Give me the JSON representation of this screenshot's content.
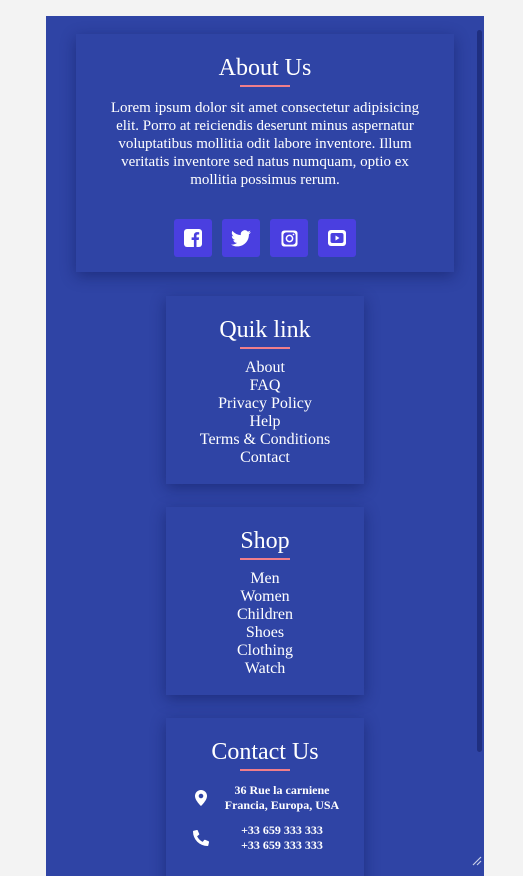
{
  "about": {
    "title": "About Us",
    "text": "Lorem ipsum dolor sit amet consectetur adipisicing elit. Porro at reiciendis deserunt minus aspernatur voluptatibus mollitia odit labore inventore. Illum veritatis inventore sed natus numquam, optio ex mollitia possimus rerum.",
    "socials": [
      "facebook-icon",
      "twitter-icon",
      "instagram-icon",
      "youtube-icon"
    ]
  },
  "quik": {
    "title": "Quik link",
    "links": [
      "About",
      "FAQ",
      "Privacy Policy",
      "Help",
      "Terms & Conditions",
      "Contact"
    ]
  },
  "shop": {
    "title": "Shop",
    "links": [
      "Men",
      "Women",
      "Children",
      "Shoes",
      "Clothing",
      "Watch"
    ]
  },
  "contact": {
    "title": "Contact Us",
    "address": "36 Rue la carniene Francia, Europa, USA",
    "phones": [
      "+33 659 333 333",
      "+33 659 333 333"
    ]
  },
  "colors": {
    "background": "#2f44a5",
    "accent_underline": "#f07e8a",
    "social_button": "#4a3fe0"
  }
}
